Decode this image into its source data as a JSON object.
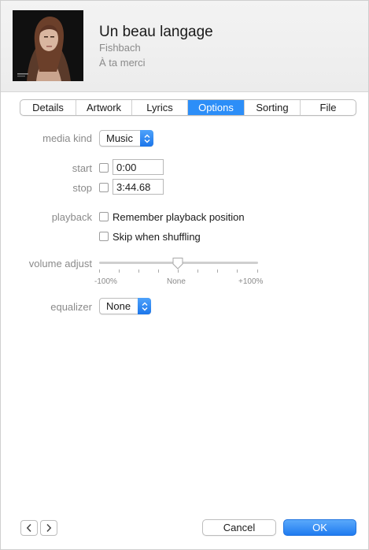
{
  "song": {
    "title": "Un beau langage",
    "artist": "Fishbach",
    "album": "À ta merci"
  },
  "tabs": [
    {
      "label": "Details",
      "active": false
    },
    {
      "label": "Artwork",
      "active": false
    },
    {
      "label": "Lyrics",
      "active": false
    },
    {
      "label": "Options",
      "active": true
    },
    {
      "label": "Sorting",
      "active": false
    },
    {
      "label": "File",
      "active": false
    }
  ],
  "options": {
    "media_kind_label": "media kind",
    "media_kind_value": "Music",
    "start_label": "start",
    "start_checked": false,
    "start_value": "0:00",
    "stop_label": "stop",
    "stop_checked": false,
    "stop_value": "3:44.68",
    "playback_label": "playback",
    "remember_position_label": "Remember playback position",
    "remember_position_checked": false,
    "skip_shuffling_label": "Skip when shuffling",
    "skip_shuffling_checked": false,
    "volume_label": "volume adjust",
    "volume_min_label": "-100%",
    "volume_mid_label": "None",
    "volume_max_label": "+100%",
    "volume_value_percent": 0,
    "equalizer_label": "equalizer",
    "equalizer_value": "None"
  },
  "footer": {
    "cancel_label": "Cancel",
    "ok_label": "OK"
  },
  "colors": {
    "accent": "#2c8ef8",
    "secondary_text": "#8a8a8a"
  }
}
